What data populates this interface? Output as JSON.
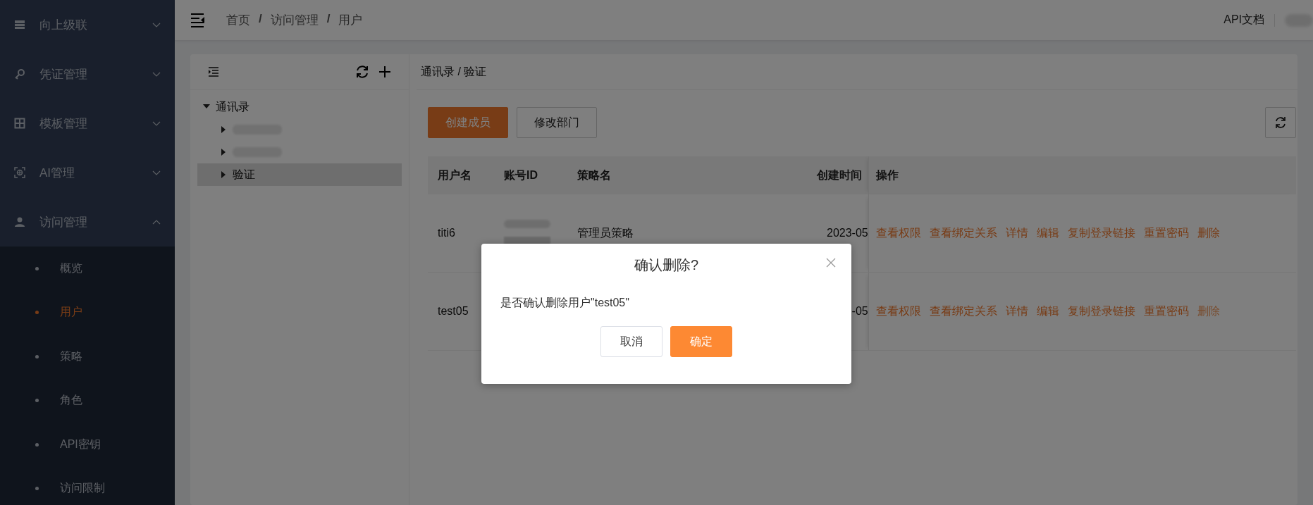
{
  "sidebar": {
    "items": [
      {
        "label": "向上级联",
        "expanded": false
      },
      {
        "label": "凭证管理",
        "expanded": false
      },
      {
        "label": "模板管理",
        "expanded": false
      },
      {
        "label": "AI管理",
        "expanded": false
      },
      {
        "label": "访问管理",
        "expanded": true,
        "children": [
          {
            "label": "概览",
            "selected": false
          },
          {
            "label": "用户",
            "selected": true
          },
          {
            "label": "策略",
            "selected": false
          },
          {
            "label": "角色",
            "selected": false
          },
          {
            "label": "API密钥",
            "selected": false
          },
          {
            "label": "访问限制",
            "selected": false
          }
        ]
      }
    ]
  },
  "breadcrumb": {
    "items": [
      "首页",
      "访问管理",
      "用户"
    ],
    "separator": "/"
  },
  "top_right": {
    "docs_link": "API文档"
  },
  "tree": {
    "nodes": [
      {
        "kind": "node",
        "label": "通讯录",
        "expanded": true,
        "selected": false,
        "children": [
          {
            "kind": "redacted",
            "expanded": false,
            "selected": false
          },
          {
            "kind": "redacted",
            "expanded": false,
            "selected": false
          },
          {
            "kind": "node",
            "label": "验证",
            "expanded": false,
            "selected": true
          }
        ]
      }
    ]
  },
  "content": {
    "path": "通讯录 / 验证",
    "buttons": [
      {
        "label": "创建成员",
        "kind": "primary"
      },
      {
        "label": "修改部门",
        "kind": "default"
      }
    ]
  },
  "table": {
    "columns": [
      "用户名",
      "账号ID",
      "策略名",
      "创建时间",
      "操作"
    ],
    "rows": [
      {
        "username": "titi6",
        "account_id_redacted": true,
        "policy": "管理员策略",
        "created": "2023-05",
        "actions": [
          {
            "label": "查看权限",
            "disabled": false
          },
          {
            "label": "查看绑定关系",
            "disabled": false
          },
          {
            "label": "详情",
            "disabled": false
          },
          {
            "label": "编辑",
            "disabled": false
          },
          {
            "label": "复制登录链接",
            "disabled": false
          },
          {
            "label": "重置密码",
            "disabled": false
          },
          {
            "label": "删除",
            "disabled": false
          }
        ]
      },
      {
        "username": "test05",
        "created": "-05",
        "actions": [
          {
            "label": "查看权限",
            "disabled": false
          },
          {
            "label": "查看绑定关系",
            "disabled": false
          },
          {
            "label": "详情",
            "disabled": false
          },
          {
            "label": "编辑",
            "disabled": false
          },
          {
            "label": "复制登录链接",
            "disabled": false
          },
          {
            "label": "重置密码",
            "disabled": false
          },
          {
            "label": "删除",
            "disabled": true
          }
        ]
      }
    ]
  },
  "modal": {
    "title": "确认删除?",
    "message": "是否确认删除用户\"test05\"",
    "buttons": [
      {
        "label": "取消",
        "kind": "default"
      },
      {
        "label": "确定",
        "kind": "primary"
      }
    ]
  }
}
